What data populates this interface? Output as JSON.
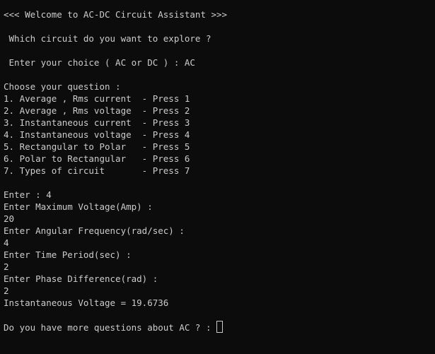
{
  "terminal": {
    "lines": [
      "<<< Welcome to AC-DC Circuit Assistant >>>",
      "",
      " Which circuit do you want to explore ?",
      "",
      " Enter your choice ( AC or DC ) : AC",
      "",
      "Choose your question :",
      "1. Average , Rms current  - Press 1",
      "2. Average , Rms voltage  - Press 2",
      "3. Instantaneous current  - Press 3",
      "4. Instantaneous voltage  - Press 4",
      "5. Rectangular to Polar   - Press 5",
      "6. Polar to Rectangular   - Press 6",
      "7. Types of circuit       - Press 7",
      "",
      "Enter : 4",
      "Enter Maximum Voltage(Amp) :",
      "20",
      "Enter Angular Frequency(rad/sec) :",
      "4",
      "Enter Time Period(sec) :",
      "2",
      "Enter Phase Difference(rad) :",
      "2",
      "Instantaneous Voltage = 19.6736",
      "",
      "Do you have more questions about AC ? : "
    ]
  },
  "colors": {
    "background": "#0c0c0c",
    "text": "#cccccc"
  }
}
